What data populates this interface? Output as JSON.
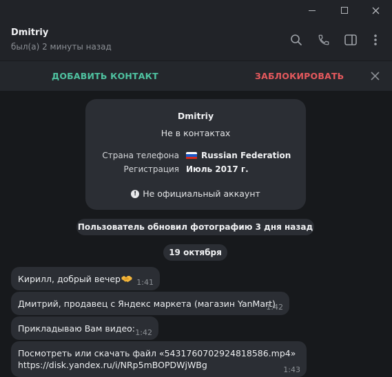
{
  "window": {
    "controls": {
      "minimize": "minimize",
      "maximize": "maximize",
      "close": "close"
    }
  },
  "header": {
    "name": "Dmitriy",
    "status": "был(а) 2 минуты назад",
    "icons": [
      "search-icon",
      "phone-icon",
      "sidebar-toggle-icon",
      "more-vertical-icon"
    ]
  },
  "action_bar": {
    "add_contact": "ДОБАВИТЬ КОНТАКТ",
    "block": "ЗАБЛОКИРОВАТЬ",
    "add_color": "#4fc3a1",
    "block_color": "#e5595d"
  },
  "info_card": {
    "name": "Dmitriy",
    "subtitle": "Не в контактах",
    "phone_country_label": "Страна телефона",
    "phone_country_value": "Russian Federation",
    "registration_label": "Регистрация",
    "registration_value": "Июль 2017 г.",
    "unofficial": "Не официальный аккаунт"
  },
  "service": {
    "photo_update": "Пользователь обновил фотографию 3 дня назад",
    "date": "19 октября"
  },
  "messages": [
    {
      "text": "Кирилл, добрый вечер",
      "emoji": "handshake",
      "time": "1:41"
    },
    {
      "text": "Дмитрий, продавец с Яндекс маркета (магазин YanMart)",
      "time": "1:42"
    },
    {
      "text": "Прикладываю Вам видео:",
      "time": "1:42"
    },
    {
      "line1": "Посмотреть или скачать файл «5431760702924818586.mp4»",
      "line2": "https://disk.yandex.ru/i/NRp5mBOPDWjWBg",
      "time": "1:43"
    }
  ],
  "colors": {
    "background": "#17191c",
    "panel": "#212328",
    "bubble": "#2b2e34"
  }
}
